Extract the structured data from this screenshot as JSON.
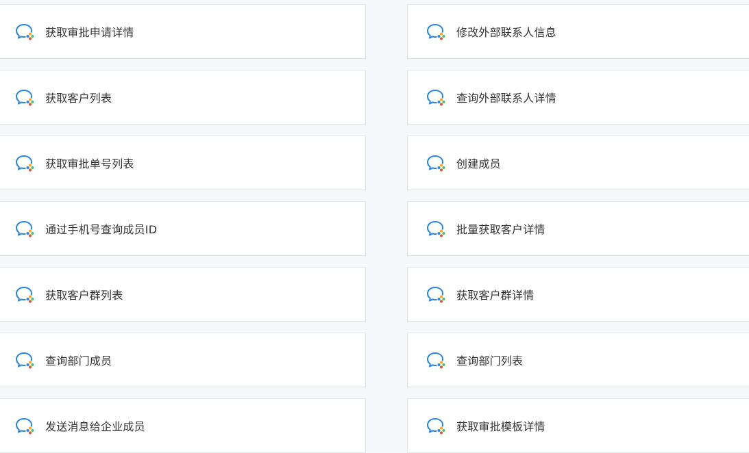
{
  "icon": "wecom-chat-icon",
  "colors": {
    "bubble": "#2b88e0",
    "dot_orange": "#f5a623",
    "dot_green": "#4cc35a",
    "dot_red": "#e94b3c",
    "dot_blue": "#2b88e0"
  },
  "cards": [
    {
      "label": "获取审批申请详情"
    },
    {
      "label": "修改外部联系人信息"
    },
    {
      "label": "获取客户列表"
    },
    {
      "label": "查询外部联系人详情"
    },
    {
      "label": "获取审批单号列表"
    },
    {
      "label": "创建成员"
    },
    {
      "label": "通过手机号查询成员ID"
    },
    {
      "label": "批量获取客户详情"
    },
    {
      "label": "获取客户群列表"
    },
    {
      "label": "获取客户群详情"
    },
    {
      "label": "查询部门成员"
    },
    {
      "label": "查询部门列表"
    },
    {
      "label": "发送消息给企业成员"
    },
    {
      "label": "获取审批模板详情"
    }
  ]
}
